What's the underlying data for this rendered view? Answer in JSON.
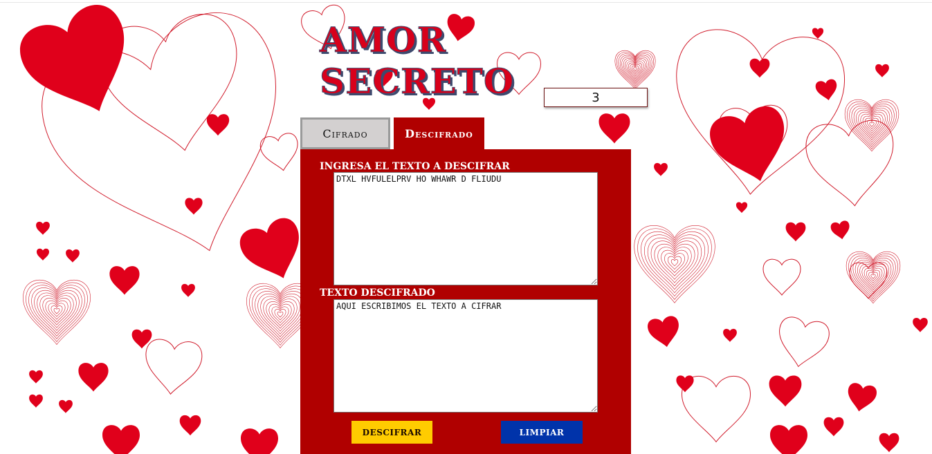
{
  "header": {
    "title": "AMOR SECRETO"
  },
  "shift": {
    "value": "3"
  },
  "tabs": [
    {
      "label": "Cifrado",
      "active": false
    },
    {
      "label": "Descifrado",
      "active": true
    }
  ],
  "form": {
    "input_label": "INGRESA EL TEXTO A DESCIFRAR",
    "input_value": "DTXL HVFULELPRV HO WHAWR D FLIUDU",
    "output_label": "TEXTO DESCIFRADO",
    "output_value": "AQUI ESCRIBIMOS EL TEXTO A CIFRAR"
  },
  "buttons": {
    "decrypt_label": "DESCIFRAR",
    "clear_label": "LIMPIAR"
  },
  "colors": {
    "accent_red": "#b00000",
    "heart_red": "#e0001b",
    "decrypt_button": "#ffcc00",
    "clear_button": "#0033aa",
    "inactive_tab": "#d3d0d0"
  }
}
